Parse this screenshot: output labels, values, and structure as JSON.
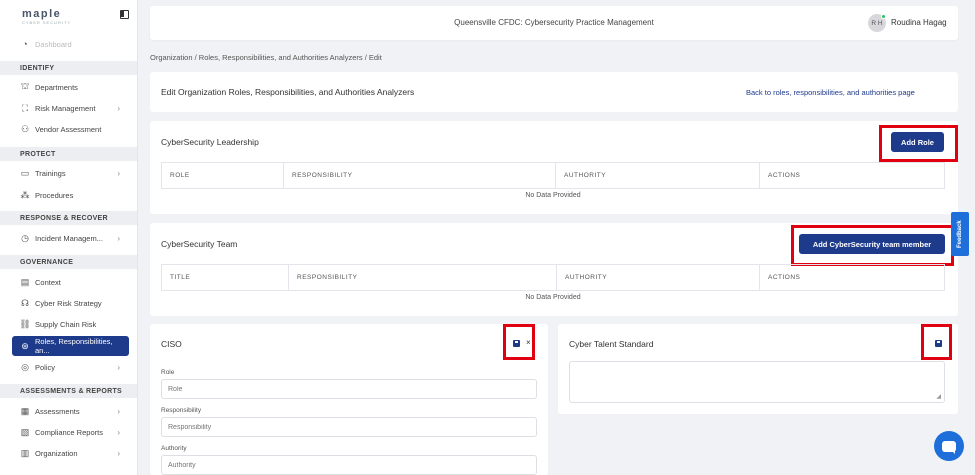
{
  "sidebar": {
    "logo": "maple",
    "logo_sub": "CYBER SECURITY",
    "faded_item": "Dashboard",
    "sections": {
      "identify": "IDENTIFY",
      "protect": "PROTECT",
      "response": "RESPONSE & RECOVER",
      "governance": "GOVERNANCE",
      "assessments": "ASSESSMENTS & REPORTS"
    },
    "items": {
      "departments": "Departments",
      "risk_management": "Risk Management",
      "vendor_assessment": "Vendor Assessment",
      "trainings": "Trainings",
      "procedures": "Procedures",
      "incident_management": "Incident Managem...",
      "context": "Context",
      "cyber_risk_strategy": "Cyber Risk Strategy",
      "supply_chain_risk": "Supply Chain Risk",
      "roles": "Roles, Responsibilities, an...",
      "policy": "Policy",
      "assessments": "Assessments",
      "compliance_reports": "Compliance Reports",
      "organization": "Organization"
    }
  },
  "header": {
    "title": "Queensville CFDC: Cybersecurity Practice Management",
    "avatar_initials": "R H",
    "user_name": "Roudina Hagag"
  },
  "breadcrumb": "Organization  /  Roles, Responsibilities, and Authorities Analyzers  /  Edit",
  "page": {
    "title": "Edit Organization Roles, Responsibilities, and Authorities Analyzers",
    "back_link": "Back to roles, responsibilities, and authorities page"
  },
  "leadership": {
    "title": "CyberSecurity Leadership",
    "add_button": "Add Role",
    "columns": [
      "ROLE",
      "RESPONSIBILITY",
      "AUTHORITY",
      "ACTIONS"
    ],
    "empty_text": "No Data Provided"
  },
  "team": {
    "title": "CyberSecurity Team",
    "add_button": "Add CyberSecurity team member",
    "columns": [
      "TITLE",
      "RESPONSIBILITY",
      "AUTHORITY",
      "ACTIONS"
    ],
    "empty_text": "No Data Provided"
  },
  "ciso": {
    "title": "CISO",
    "close_glyph": "×",
    "role_label": "Role",
    "role_placeholder": "Role",
    "responsibility_label": "Responsibility",
    "responsibility_placeholder": "Responsibility",
    "authority_label": "Authority",
    "authority_placeholder": "Authority"
  },
  "talent": {
    "title": "Cyber Talent Standard"
  },
  "feedback_label": "Feedback",
  "colors": {
    "primary": "#1e3a8a",
    "highlight": "#e00010",
    "feedback": "#1e6fd9"
  }
}
